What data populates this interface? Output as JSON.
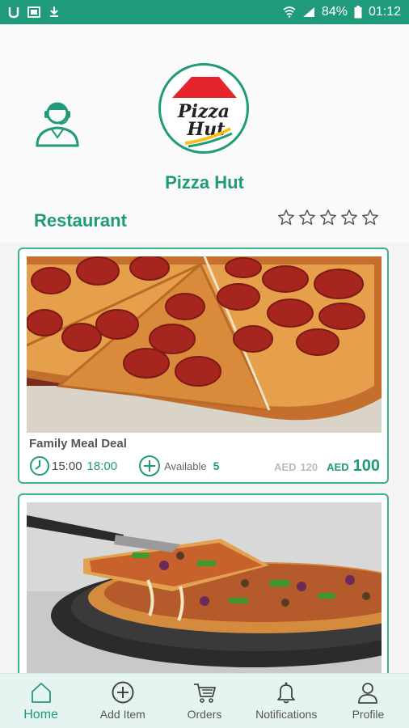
{
  "statusbar": {
    "battery": "84%",
    "time": "01:12"
  },
  "restaurant": {
    "name": "Pizza Hut",
    "logo_text_top": "Pizza",
    "logo_text_bottom": "Hut",
    "category": "Restaurant",
    "rating_stars": 5,
    "rating_value": 0
  },
  "deals": [
    {
      "title": "Family Meal Deal",
      "time_start": "15:00",
      "time_end": "18:00",
      "available_label": "Available",
      "available_count": "5",
      "old_currency": "AED",
      "old_price": "120",
      "new_currency": "AED",
      "new_price": "100"
    }
  ],
  "tabs": [
    {
      "label": "Home",
      "icon": "home-icon",
      "active": true
    },
    {
      "label": "Add Item",
      "icon": "add-circle-icon",
      "active": false
    },
    {
      "label": "Orders",
      "icon": "cart-icon",
      "active": false
    },
    {
      "label": "Notifications",
      "icon": "bell-icon",
      "active": false
    },
    {
      "label": "Profile",
      "icon": "person-icon",
      "active": false
    }
  ],
  "colors": {
    "accent": "#1f9a7a",
    "statusbar": "#1f9a7a",
    "tabbar_bg": "#e6f4f1"
  }
}
